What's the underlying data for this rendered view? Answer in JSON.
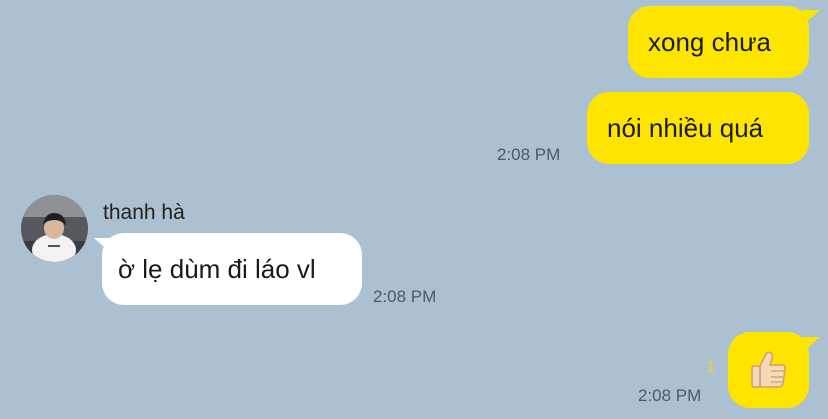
{
  "colors": {
    "background": "#abc1d1",
    "outgoing_bubble": "#fee500",
    "incoming_bubble": "#ffffff",
    "unread_count": "#f2d43a",
    "timestamp": "#4f5a63"
  },
  "messages": [
    {
      "direction": "outgoing",
      "text": "xong chưa",
      "time": ""
    },
    {
      "direction": "outgoing",
      "text": "nói nhiều quá",
      "time": "2:08 PM"
    },
    {
      "direction": "incoming",
      "sender": "thanh hà",
      "avatar_icon": "profile-photo",
      "text": "ờ lẹ dùm đi láo vl",
      "time": "2:08 PM"
    },
    {
      "direction": "outgoing",
      "emoji": "thumbs-up-icon",
      "unread": "1",
      "time": "2:08 PM"
    }
  ]
}
